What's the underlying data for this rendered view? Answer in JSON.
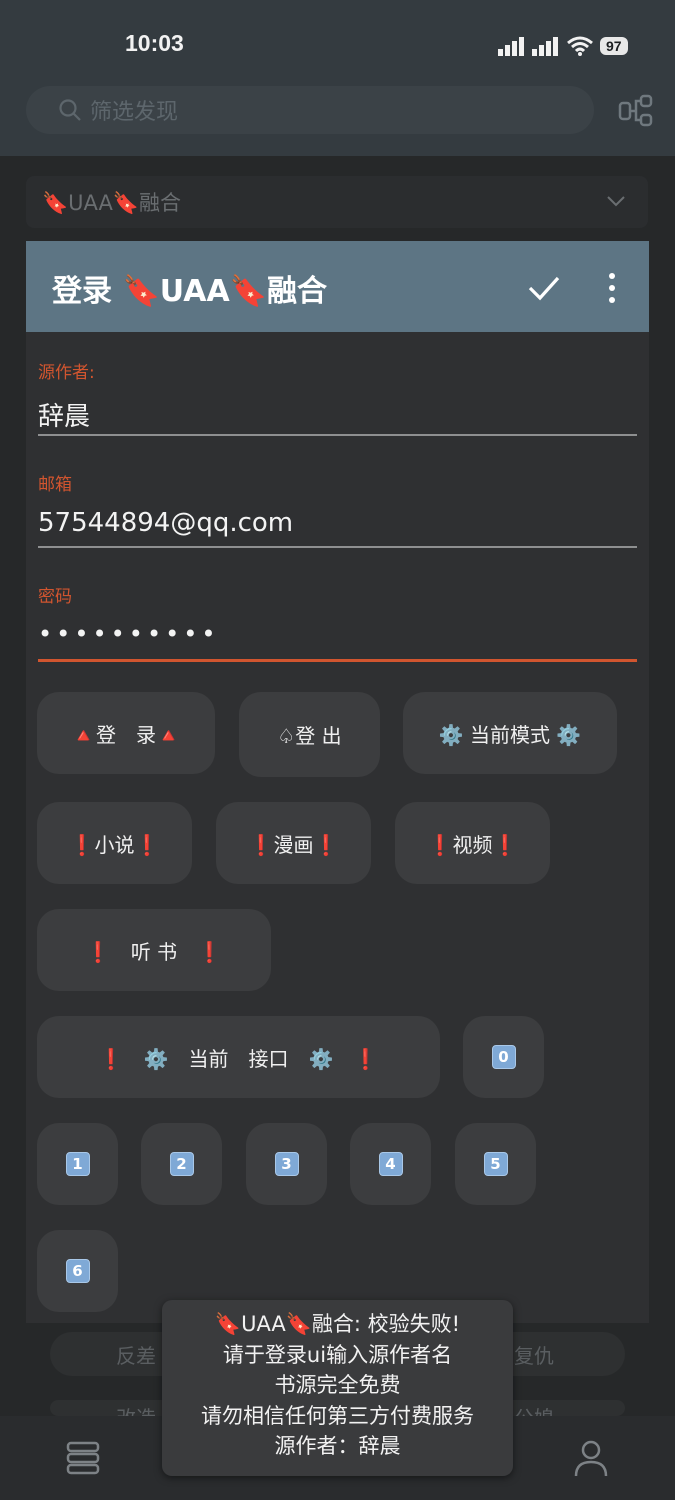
{
  "status_bar": {
    "time": "10:03",
    "battery": "97"
  },
  "search": {
    "placeholder": "筛选发现"
  },
  "source_select": {
    "label": "🔖UAA🔖融合"
  },
  "dialog": {
    "title": "登录 🔖UAA🔖融合",
    "fields": [
      {
        "label": "源作者:",
        "value": "辞晨"
      },
      {
        "label": "邮箱",
        "value": "57544894@qq.com"
      },
      {
        "label": "密码",
        "value": "••••••••••"
      }
    ],
    "buttons": {
      "login": "🔺登　录🔺",
      "logout": "♤登 出",
      "mode": "⚙️ 当前模式 ⚙️",
      "novel": "❗小说❗",
      "comic": "❗漫画❗",
      "video": "❗视频❗",
      "audio": "❗　听 书　❗",
      "interface": "❗　⚙️　当前　接口　⚙️　❗",
      "keys": [
        "0",
        "1",
        "2",
        "3",
        "4",
        "5",
        "6"
      ]
    }
  },
  "background_chips": {
    "row1_left": "反差",
    "row1_right": "复仇",
    "row2_left": "改造",
    "row2_right": "公媳"
  },
  "toast": {
    "lines": [
      "🔖UAA🔖融合: 校验失败!",
      "请于登录ui输入源作者名",
      "书源完全免费",
      "请勿相信任何第三方付费服务",
      "源作者：辞晨"
    ]
  }
}
